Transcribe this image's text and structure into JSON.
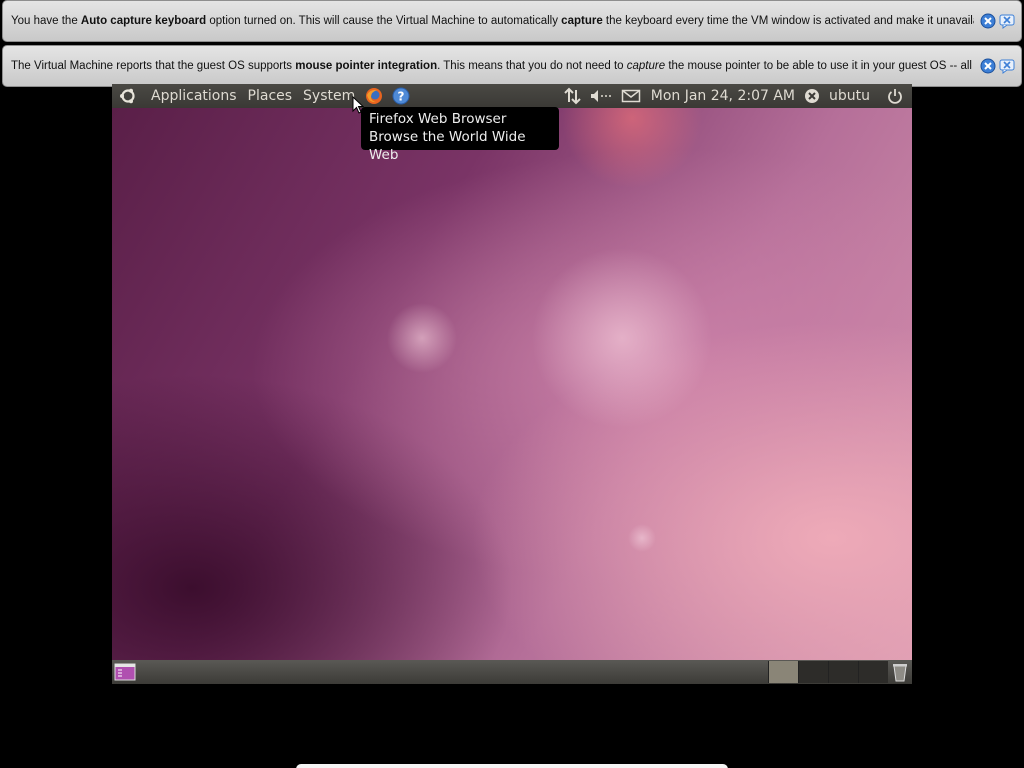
{
  "notices": [
    {
      "parts": [
        {
          "t": "You have the ",
          "b": false
        },
        {
          "t": "Auto capture keyboard",
          "b": true
        },
        {
          "t": " option turned on. This will cause the Virtual Machine to automatically ",
          "b": false
        },
        {
          "t": "capture",
          "b": true
        },
        {
          "t": " the keyboard every time the VM window is activated and make it unavailable to",
          "b": false
        }
      ]
    },
    {
      "parts": [
        {
          "t": "The Virtual Machine reports that the guest OS supports ",
          "b": false
        },
        {
          "t": "mouse pointer integration",
          "b": true
        },
        {
          "t": ". This means that you do not need to ",
          "b": false
        },
        {
          "t": "capture",
          "i": true
        },
        {
          "t": " the mouse pointer to be able to use it in your guest OS -- all mouse",
          "b": false
        }
      ]
    }
  ],
  "top_panel": {
    "menus": [
      "Applications",
      "Places",
      "System"
    ],
    "clock": "Mon Jan 24,  2:07 AM",
    "user": "ubutu",
    "icons": [
      "ubuntu-logo-icon",
      "firefox-icon",
      "help-icon",
      "network-icon",
      "volume-icon",
      "mail-icon",
      "user-status-icon",
      "power-icon"
    ]
  },
  "tooltip": {
    "line1": "Firefox Web Browser",
    "line2": "Browse the World Wide Web"
  },
  "colors": {
    "panel": "#3c3b37",
    "desktop_accent": "#b56f99",
    "notice_bg": "#d6d6d6"
  }
}
